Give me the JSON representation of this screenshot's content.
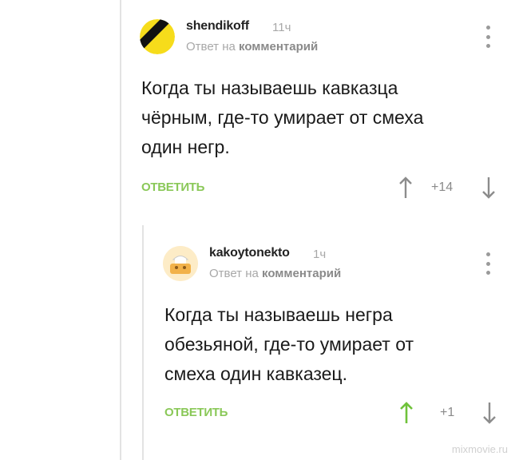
{
  "comments": [
    {
      "author": "shendikoff",
      "time": "11ч",
      "reply_prefix": "Ответ на ",
      "reply_target": "комментарий",
      "text": "Когда ты называешь кавказца\nчёрным, где-то умирает от смеха\nодин негр.",
      "reply_label": "ОТВЕТИТЬ",
      "score": "+14",
      "upvoted": false,
      "avatar_icon": "striped-circle-avatar"
    },
    {
      "author": "kakoytonekto",
      "time": "1ч",
      "reply_prefix": "Ответ на ",
      "reply_target": "комментарий",
      "text": "Когда ты называешь негра\nобезьяной, где-то умирает от\nсмеха один кавказец.",
      "reply_label": "ОТВЕТИТЬ",
      "score": "+1",
      "upvoted": true,
      "avatar_icon": "cartoon-avatar"
    }
  ],
  "watermark": "mixmovie.ru",
  "colors": {
    "accent_green": "#8ac858",
    "muted_gray": "#a8a8a8",
    "arrow_gray": "#8c8c8c",
    "arrow_active": "#6fc23a",
    "avatar_yellow": "#f6dc1b",
    "avatar_black": "#111111"
  }
}
